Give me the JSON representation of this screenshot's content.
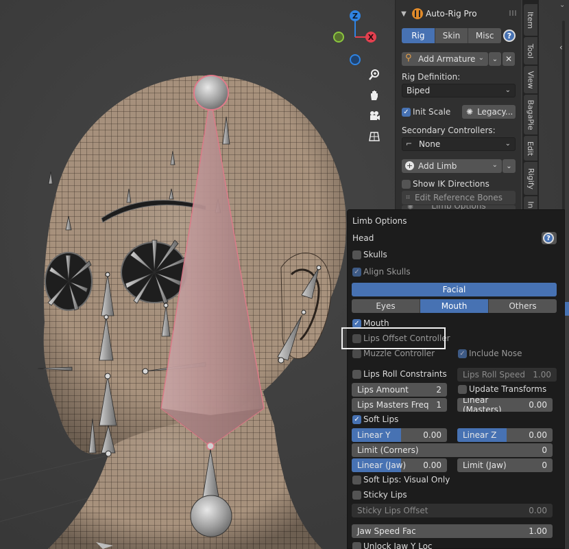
{
  "addon": {
    "title": "Auto-Rig Pro",
    "tabs": [
      {
        "label": "Rig",
        "active": true
      },
      {
        "label": "Skin",
        "active": false
      },
      {
        "label": "Misc",
        "active": false
      }
    ],
    "help_symbol": "?",
    "add_armature": "Add Armature",
    "rig_definition_label": "Rig Definition:",
    "rig_definition_value": "Biped",
    "init_scale_label": "Init Scale",
    "init_scale_checked": true,
    "legacy_label": "Legacy...",
    "secondary_label": "Secondary Controllers:",
    "secondary_value": "None",
    "add_limb": "Add Limb",
    "show_ik_label": "Show IK Directions",
    "edit_ref_bones": "Edit Reference Bones",
    "limb_options_partial": "Limb Options"
  },
  "side_tabs": [
    "Item",
    "Tool",
    "View",
    "BagaPie",
    "Edit",
    "Rigify",
    "In"
  ],
  "gizmo": {
    "z": "Z",
    "x": "X"
  },
  "popup": {
    "title": "Limb Options",
    "limb_name": "Head",
    "skulls": "Skulls",
    "align_skulls": "Align Skulls",
    "facial_label": "Facial",
    "facial_tabs": [
      {
        "label": "Eyes",
        "active": false
      },
      {
        "label": "Mouth",
        "active": true
      },
      {
        "label": "Others",
        "active": false
      }
    ],
    "mouth": "Mouth",
    "lips_offset": "Lips Offset Controller",
    "muzzle": "Muzzle Controller",
    "include_nose": "Include Nose",
    "lips_roll_constraints": "Lips Roll Constraints",
    "lips_roll_speed": {
      "label": "Lips Roll Speed",
      "value": "1.00"
    },
    "lips_amount": {
      "label": "Lips Amount",
      "value": "2"
    },
    "update_transforms": "Update Transforms",
    "lips_masters_freq": {
      "label": "Lips Masters Freq",
      "value": "1"
    },
    "linear_masters": {
      "label": "Linear (Masters)",
      "value": "0.00"
    },
    "soft_lips": "Soft Lips",
    "linear_y": {
      "label": "Linear Y",
      "value": "0.00"
    },
    "linear_z": {
      "label": "Linear Z",
      "value": "0.00"
    },
    "limit_corners": {
      "label": "Limit (Corners)",
      "value": "0"
    },
    "linear_jaw": {
      "label": "Linear (Jaw)",
      "value": "0.00"
    },
    "limit_jaw": {
      "label": "Limit (Jaw)",
      "value": "0"
    },
    "soft_lips_visual": "Soft Lips: Visual Only",
    "sticky_lips": "Sticky Lips",
    "sticky_lips_offset": {
      "label": "Sticky Lips Offset",
      "value": "0.00"
    },
    "jaw_speed_fac": {
      "label": "Jaw Speed Fac",
      "value": "1.00"
    },
    "unlock_jaw_y": "Unlock Jaw Y Loc"
  },
  "colors": {
    "accent": "#4772b3",
    "panel": "#303030",
    "popup": "#1c1c1c",
    "skin": "#a08a76",
    "bone_selected": "#e07a8a",
    "axis_x": "#e4404f",
    "axis_y": "#8bc63f",
    "axis_z": "#2f84e3"
  }
}
